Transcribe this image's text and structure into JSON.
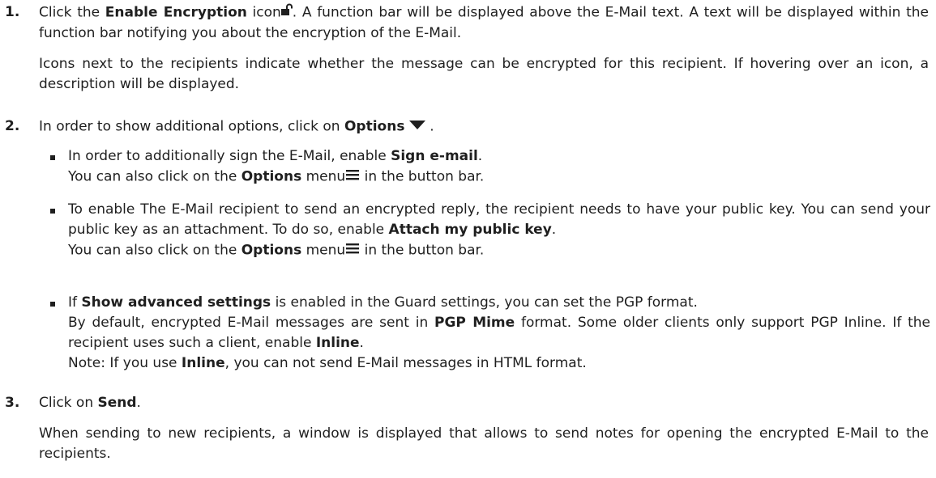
{
  "steps": [
    {
      "number": "1.",
      "p1": {
        "a": "Click the ",
        "b": "Enable Encryption",
        "c": " icon",
        "icon": "unlocked-padlock-icon",
        "d": ". A function bar will be displayed above the E-Mail text. A text will be displayed within the function bar notifying you about the encryption of the E-Mail."
      },
      "p2": "Icons next to the recipients indicate whether the message can be encrypted for this recipient. If hovering over an icon, a description will be displayed."
    },
    {
      "number": "2.",
      "p1": {
        "a": "In order to show additional options, click on ",
        "b": "Options",
        "icon": "caret-down-icon",
        "c": " ."
      },
      "bullets": [
        {
          "line1": {
            "a": "In order to additionally sign the E-Mail, enable ",
            "b": "Sign e-mail",
            "c": "."
          },
          "line2": {
            "a": "You can also click on the ",
            "b": "Options",
            "c": " menu",
            "icon": "hamburger-menu-icon",
            "d": " in the button bar."
          }
        },
        {
          "line1": {
            "a": "To enable The E-Mail recipient to send an encrypted reply, the recipient needs to have your public key. You can send your public key as an attachment. To do so, enable ",
            "b": "Attach my public key",
            "c": "."
          },
          "line2": {
            "a": "You can also click on the ",
            "b": "Options",
            "c": " menu",
            "icon": "hamburger-menu-icon",
            "d": " in the button bar."
          }
        },
        {
          "line1": {
            "a": "If ",
            "b": "Show advanced settings",
            "c": " is enabled in the Guard settings, you can set the PGP format."
          },
          "line2": {
            "a": "By default, encrypted E-Mail messages are sent in ",
            "b": "PGP Mime",
            "c": " format. Some older clients only support PGP Inline. If the recipient uses such a client, enable ",
            "d": "Inline",
            "e": "."
          },
          "line3": {
            "a": "Note: If you use ",
            "b": "Inline",
            "c": ", you can not send E-Mail messages in HTML format."
          }
        }
      ]
    },
    {
      "number": "3.",
      "p1": {
        "a": "Click on ",
        "b": "Send",
        "c": "."
      },
      "p2": "When sending to new recipients, a window is displayed that allows to send notes for opening the encrypted E-Mail to the recipients."
    }
  ]
}
